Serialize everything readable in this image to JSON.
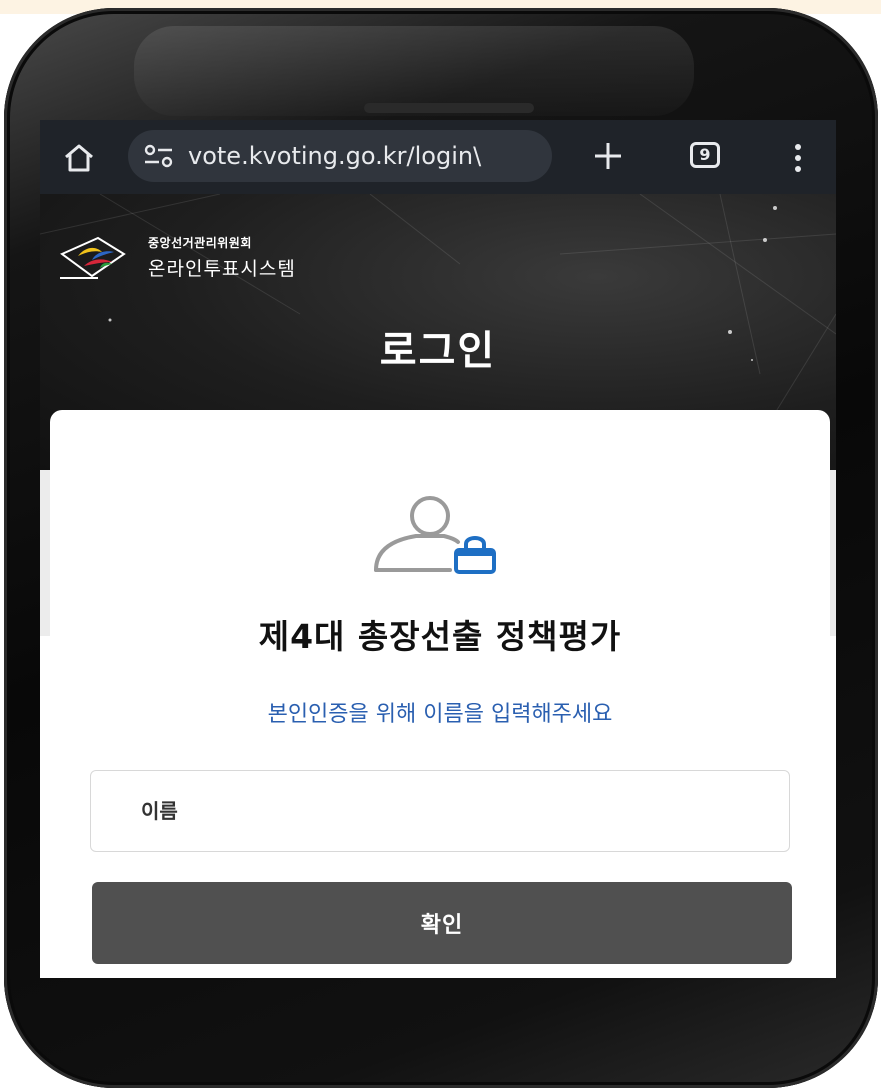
{
  "browser": {
    "url": "vote.kvoting.go.kr/login\\",
    "tab_count": "9",
    "icons": [
      "home-icon",
      "site-settings-icon",
      "plus-icon",
      "tabs-icon",
      "menu-icon"
    ]
  },
  "header": {
    "org_name": "중앙선거관리위원회",
    "system_name": "온라인투표시스템",
    "page_title": "로그인"
  },
  "login_card": {
    "election_title": "제4대 총장선출 정책평가",
    "instruction": "본인인증을 위해 이름을 입력해주세요",
    "name_placeholder": "이름",
    "confirm_label": "확인",
    "icon": "user-lock-icon"
  },
  "colors": {
    "browser_bar": "#1f2329",
    "accent_blue": "#2a5fb0",
    "button_gray": "#505050",
    "lock_blue": "#1e6fc4"
  }
}
